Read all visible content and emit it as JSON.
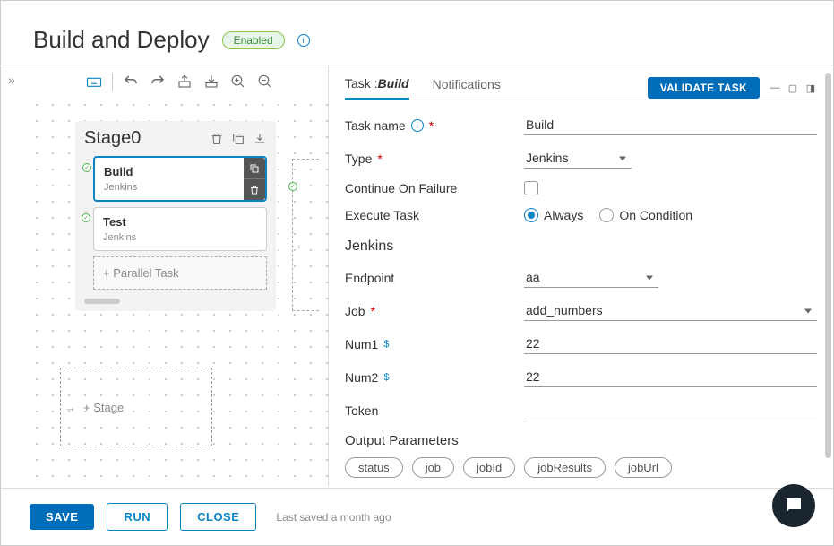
{
  "header": {
    "title": "Build and Deploy",
    "badge": "Enabled"
  },
  "stage": {
    "name": "Stage0",
    "tasks": [
      {
        "title": "Build",
        "subtitle": "Jenkins"
      },
      {
        "title": "Test",
        "subtitle": "Jenkins"
      }
    ],
    "parallel_label": "+ Parallel Task"
  },
  "add_stage_label": "+ Stage",
  "panel": {
    "tabs": {
      "task_prefix": "Task :",
      "task_name": "Build",
      "notifications": "Notifications"
    },
    "validate_btn": "VALIDATE TASK",
    "fields": {
      "task_name_label": "Task name",
      "task_name_value": "Build",
      "type_label": "Type",
      "type_value": "Jenkins",
      "cof_label": "Continue On Failure",
      "exec_label": "Execute Task",
      "exec_always": "Always",
      "exec_cond": "On Condition"
    },
    "jenkins": {
      "heading": "Jenkins",
      "endpoint_label": "Endpoint",
      "endpoint_value": "aa",
      "job_label": "Job",
      "job_value": "add_numbers",
      "num1_label": "Num1",
      "num1_value": "22",
      "num2_label": "Num2",
      "num2_value": "22",
      "token_label": "Token",
      "token_value": ""
    },
    "output": {
      "heading": "Output Parameters",
      "chips": [
        "status",
        "job",
        "jobId",
        "jobResults",
        "jobUrl"
      ]
    }
  },
  "footer": {
    "save": "SAVE",
    "run": "RUN",
    "close": "CLOSE",
    "status": "Last saved a month ago"
  }
}
